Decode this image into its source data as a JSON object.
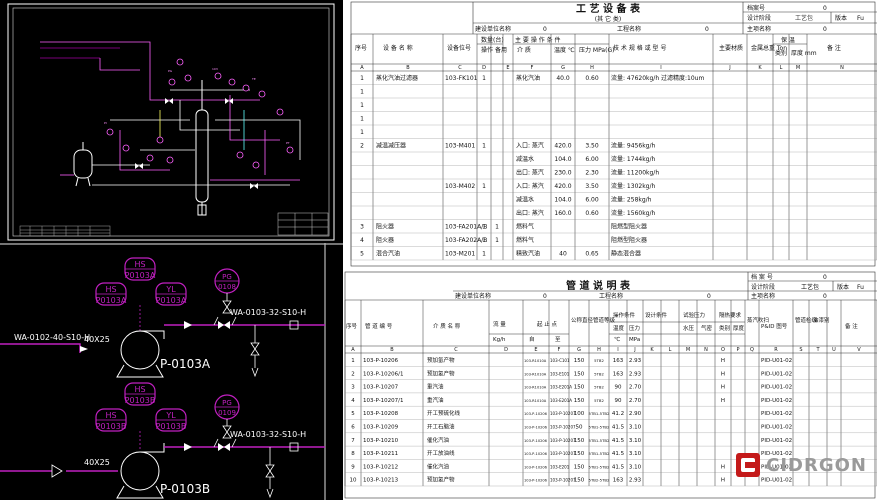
{
  "cad_top": {
    "pid_labels": [
      "PG",
      "103",
      "TE",
      "PI",
      "PT"
    ]
  },
  "cad_bottom": {
    "pump_a": "P-0103A",
    "pump_b": "P-0103B",
    "hs_a": [
      "HS",
      "P0103A"
    ],
    "hsb_a": [
      "HS",
      "P0103A"
    ],
    "yl_a": [
      "YL",
      "P0103A"
    ],
    "pg_a": [
      "PG",
      "0108"
    ],
    "hs_b": [
      "HS",
      "P0103B"
    ],
    "hsb_b": [
      "HS",
      "P0103B"
    ],
    "yl_b": [
      "YL",
      "P0103B"
    ],
    "pg_b": [
      "PG",
      "0109"
    ],
    "line_in": "WA-0102-40-S10-H",
    "reducer": "40X25",
    "line_out_a": "WA-0103-32-S10-H",
    "line_out_b": "WA-0103-32-S10-H",
    "reducer_b": "40X25"
  },
  "equipment_table": {
    "title": "工 艺 设 备 表",
    "subtitle": "(其 它 类)",
    "doc_no_label": "档案号",
    "doc_no_value": "0",
    "stage_label": "设计阶段",
    "stage_value": "工艺包",
    "version_label": "版本",
    "version_value": "Fu",
    "unit_label": "建设单位名称",
    "unit_value": "0",
    "project_label": "工程名称",
    "project_value": "0",
    "main_project_label": "主项名称",
    "main_project_value": "0",
    "headers": {
      "seq": "序号",
      "name": "设 备 名 称",
      "tag": "设备位号",
      "qty": "数量(台)",
      "op": "操作",
      "spare": "备用",
      "cond": "主 要 操 作 条 件",
      "medium": "介 质",
      "temp": "温度 ℃",
      "press": "压力 MPa(G)",
      "spec": "技 术 规 格 或 型 号",
      "material": "主要材质",
      "weight": "金属总重 Ton",
      "insul": "保 温",
      "insul_type": "类别",
      "insul_thk": "厚度 mm",
      "remark": "备 注"
    },
    "letters": [
      "A",
      "B",
      "C",
      "D",
      "E",
      "F",
      "G",
      "H",
      "I",
      "J",
      "K",
      "L",
      "M",
      "N"
    ],
    "rows": [
      {
        "n": "1",
        "name": "蒸化汽油过滤器",
        "tag": "103-FK101",
        "qty": "1",
        "medium": "蒸化汽油",
        "temp": "40.0",
        "press": "0.60",
        "spec": "流量: 47620kg/h 过滤精度:10um"
      },
      {
        "n": "1",
        "name": "",
        "tag": "",
        "qty": "",
        "medium": "",
        "temp": "",
        "press": "",
        "spec": ""
      },
      {
        "n": "1",
        "name": "",
        "tag": "",
        "qty": "",
        "medium": "",
        "temp": "",
        "press": "",
        "spec": ""
      },
      {
        "n": "1",
        "name": "",
        "tag": "",
        "qty": "",
        "medium": "",
        "temp": "",
        "press": "",
        "spec": ""
      },
      {
        "n": "1",
        "name": "",
        "tag": "",
        "qty": "",
        "medium": "",
        "temp": "",
        "press": "",
        "spec": ""
      },
      {
        "n": "2",
        "name": "减温减压器",
        "tag": "103-M401",
        "qty": "1",
        "medium": "入口: 蒸汽",
        "temp": "420.0",
        "press": "3.50",
        "spec": "流量: 9456kg/h"
      },
      {
        "n": "",
        "name": "",
        "tag": "",
        "qty": "",
        "medium": "减温水",
        "temp": "104.0",
        "press": "6.00",
        "spec": "流量: 1744kg/h"
      },
      {
        "n": "",
        "name": "",
        "tag": "",
        "qty": "",
        "medium": "出口: 蒸汽",
        "temp": "230.0",
        "press": "2.30",
        "spec": "流量: 11200kg/h"
      },
      {
        "n": "",
        "name": "",
        "tag": "103-M402",
        "qty": "1",
        "medium": "入口: 蒸汽",
        "temp": "420.0",
        "press": "3.50",
        "spec": "流量: 1302kg/h"
      },
      {
        "n": "",
        "name": "",
        "tag": "",
        "qty": "",
        "medium": "减温水",
        "temp": "104.0",
        "press": "6.00",
        "spec": "流量: 258kg/h"
      },
      {
        "n": "",
        "name": "",
        "tag": "",
        "qty": "",
        "medium": "出口: 蒸汽",
        "temp": "160.0",
        "press": "0.60",
        "spec": "流量: 1560kg/h"
      },
      {
        "n": "3",
        "name": "阻火器",
        "tag": "103-FA201A/B",
        "qty": "1",
        "spare": "1",
        "medium": "燃料气",
        "temp": "",
        "press": "",
        "spec": "阻燃型阻火器"
      },
      {
        "n": "4",
        "name": "阻火器",
        "tag": "103-FA202A/B",
        "qty": "1",
        "spare": "1",
        "medium": "燃料气",
        "temp": "",
        "press": "",
        "spec": "阻燃型阻火器"
      },
      {
        "n": "5",
        "name": "混合汽油",
        "tag": "103-M201",
        "qty": "1",
        "medium": "精致汽油",
        "temp": "40",
        "press": "0.65",
        "spec": "静态混合器"
      }
    ]
  },
  "pipe_table": {
    "title": "管 道 说 明 表",
    "doc_no_label": "档 案 号",
    "doc_no_value": "0",
    "stage_label": "设计阶段",
    "stage_value": "工艺包",
    "version_label": "版本",
    "version_value": "Fu",
    "unit_label": "建设单位名称",
    "unit_value": "0",
    "project_label": "工程名称",
    "project_value": "0",
    "main_project_label": "主项名称",
    "main_project_value": "0",
    "headers": {
      "seq": "序号",
      "code": "管 道 编 号",
      "medium": "介 质 名 称",
      "flow": "流 量",
      "flow_unit": "Kg/h",
      "from_to": "起 止 点",
      "from": "自",
      "to": "至",
      "dn": "公称直径",
      "grade": "管道等级",
      "op_cond": "操作条件",
      "design_cond": "设计条件",
      "test": "试验压力",
      "insul": "隔热要求",
      "temp": "温度",
      "press": "压力",
      "temp_unit": "℃",
      "press_unit": "MPa",
      "water": "水压",
      "gas": "气密",
      "cat": "类别",
      "thk": "厚度",
      "steam": "蒸汽吹扫",
      "pid": "P&ID 图号",
      "inspect": "管道检级",
      "paint": "油漆别",
      "remark": "备 注"
    },
    "letters": [
      "A",
      "B",
      "C",
      "D",
      "E",
      "F",
      "G",
      "H",
      "I",
      "J",
      "K",
      "L",
      "M",
      "N",
      "O",
      "P",
      "Q",
      "R",
      "S",
      "T",
      "U",
      "V"
    ],
    "rows": [
      {
        "n": "1",
        "code": "103-P-10206",
        "medium": "预加氢产物",
        "from": "103-R1010A",
        "to": "103-C101",
        "dn": "150",
        "grade": "5TB2",
        "temp": "163",
        "press": "2.93",
        "cat": "H",
        "pid": "PID-U01-02"
      },
      {
        "n": "2",
        "code": "103-P-10206/1",
        "medium": "预加氢产物",
        "from": "103-R1010A",
        "to": "103-E101",
        "dn": "150",
        "grade": "5TB2",
        "temp": "163",
        "press": "2.93",
        "cat": "H",
        "pid": "PID-U01-02"
      },
      {
        "n": "3",
        "code": "103-P-10207",
        "medium": "重汽油",
        "from": "103-R1010A",
        "to": "103-E201A",
        "dn": "150",
        "grade": "5TB2",
        "temp": "90",
        "press": "2.70",
        "cat": "H",
        "pid": "PID-U01-02"
      },
      {
        "n": "4",
        "code": "103-P-10207/1",
        "medium": "重汽油",
        "from": "103-R1010A",
        "to": "103-E201A",
        "dn": "150",
        "grade": "5TB2",
        "temp": "90",
        "press": "2.70",
        "cat": "H",
        "pid": "PID-U01-02"
      },
      {
        "n": "5",
        "code": "103-P-10208",
        "medium": "开工预硫化线",
        "from": "103-P-10206",
        "to": "103-P-10207",
        "dn": "100",
        "grade": "5TB1-5TB2",
        "temp": "41.2",
        "press": "2.90",
        "cat": "",
        "pid": "PID-U01-02"
      },
      {
        "n": "6",
        "code": "103-P-10209",
        "medium": "开工石脑油",
        "from": "103-P-10206",
        "to": "103-P-10207",
        "dn": "50",
        "grade": "5TB1-5TB2",
        "temp": "41.5",
        "press": "3.10",
        "cat": "",
        "pid": "PID-U01-02"
      },
      {
        "n": "7",
        "code": "103-P-10210",
        "medium": "催化汽油",
        "from": "103-P-10206",
        "to": "103-P-10207",
        "dn": "150",
        "grade": "5TB1-5TB2",
        "temp": "41.5",
        "press": "3.10",
        "cat": "",
        "pid": "PID-U01-02"
      },
      {
        "n": "8",
        "code": "103-P-10211",
        "medium": "开工放油线",
        "from": "103-P-10206",
        "to": "103-P-10207",
        "dn": "150",
        "grade": "5TB1-5TB2",
        "temp": "41.5",
        "press": "3.10",
        "cat": "",
        "pid": "PID-U01-02"
      },
      {
        "n": "9",
        "code": "103-P-10212",
        "medium": "催化汽油",
        "from": "103-P-10206",
        "to": "103-E201",
        "dn": "150",
        "grade": "5TB1-5TB2",
        "temp": "41.5",
        "press": "3.10",
        "cat": "H",
        "pid": "PID-U01-02"
      },
      {
        "n": "10",
        "code": "103-P-10213",
        "medium": "预加氢产物",
        "from": "103-P-10206",
        "to": "103-P-10207",
        "dn": "150",
        "grade": "5TB2-5TB2",
        "temp": "163",
        "press": "2.93",
        "cat": "H",
        "pid": "PID-U01-02"
      }
    ]
  },
  "logo": {
    "text": "CIDRGON"
  }
}
